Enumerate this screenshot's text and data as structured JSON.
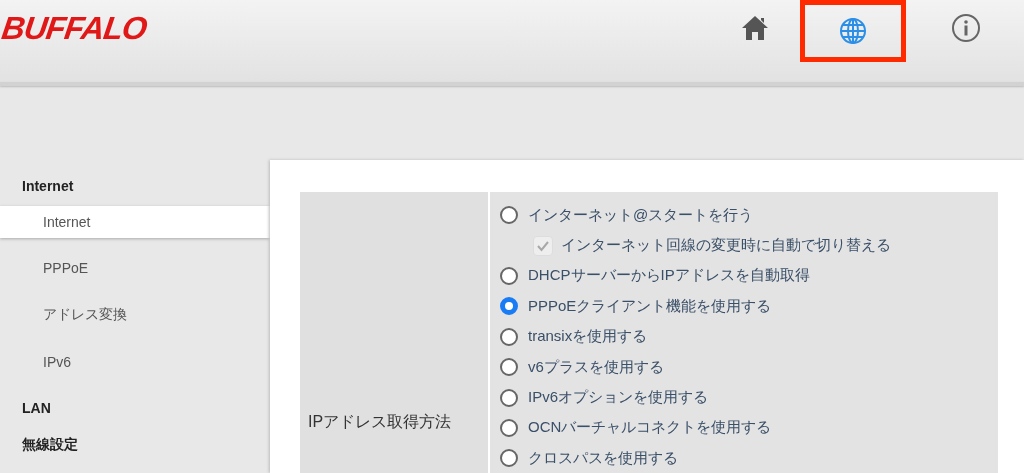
{
  "header": {
    "logo": "BUFFALO",
    "nav": [
      {
        "kind": "home",
        "highlighted": false
      },
      {
        "kind": "globe",
        "highlighted": true
      },
      {
        "kind": "info",
        "highlighted": false
      }
    ]
  },
  "sidebar": {
    "sections": [
      {
        "label": "Internet",
        "children": [
          {
            "label": "Internet",
            "selected": true
          },
          {
            "label": "PPPoE",
            "selected": false
          },
          {
            "label": "アドレス変換",
            "selected": false
          },
          {
            "label": "IPv6",
            "selected": false
          }
        ]
      },
      {
        "label": "LAN"
      },
      {
        "label": "無線設定"
      }
    ]
  },
  "form": {
    "label": "IPアドレス取得方法",
    "options": [
      {
        "kind": "radio",
        "label": "インターネット@スタートを行う",
        "selected": false
      },
      {
        "kind": "checkbox",
        "label": "インターネット回線の変更時に自動で切り替える",
        "checked": true,
        "disabled": true
      },
      {
        "kind": "radio",
        "label": "DHCPサーバーからIPアドレスを自動取得",
        "selected": false
      },
      {
        "kind": "radio",
        "label": "PPPoEクライアント機能を使用する",
        "selected": true
      },
      {
        "kind": "radio",
        "label": "transixを使用する",
        "selected": false
      },
      {
        "kind": "radio",
        "label": "v6プラスを使用する",
        "selected": false
      },
      {
        "kind": "radio",
        "label": "IPv6オプションを使用する",
        "selected": false
      },
      {
        "kind": "radio",
        "label": "OCNバーチャルコネクトを使用する",
        "selected": false
      },
      {
        "kind": "radio",
        "label": "クロスパスを使用する",
        "selected": false
      }
    ]
  }
}
